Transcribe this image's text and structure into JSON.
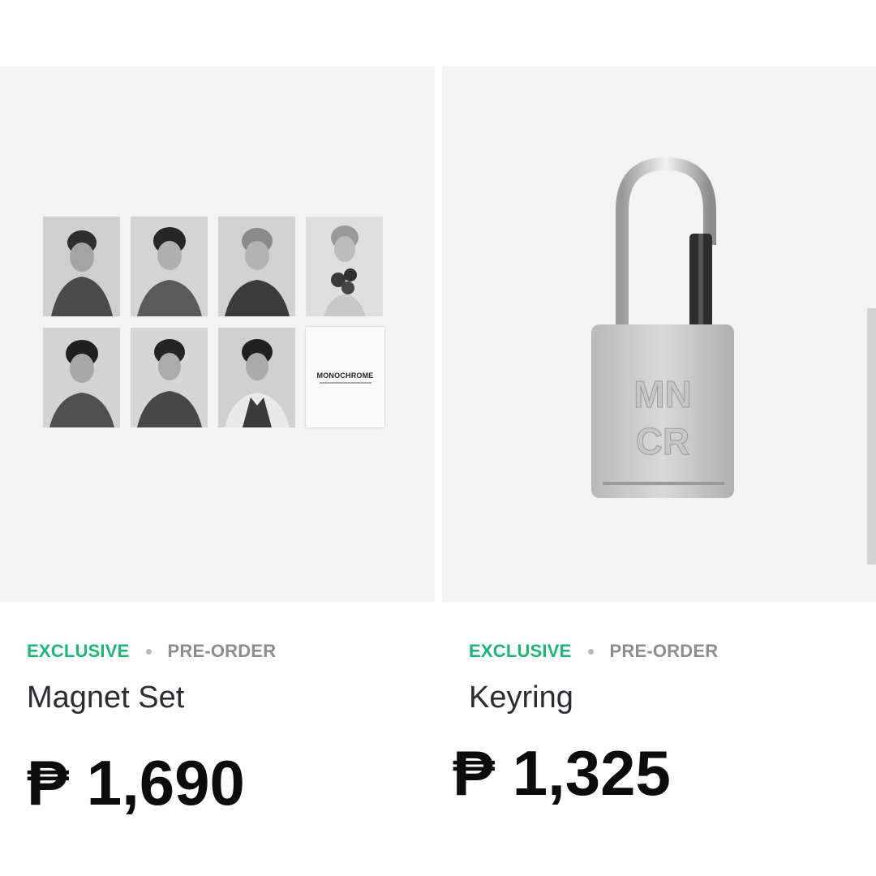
{
  "products": [
    {
      "image_alt": "magnet-set-image",
      "badge_exclusive": "EXCLUSIVE",
      "badge_preorder": "PRE-ORDER",
      "name": "Magnet Set",
      "price": "₱ 1,690",
      "magnet_card_title": "MONOCHROME"
    },
    {
      "image_alt": "keyring-image",
      "badge_exclusive": "EXCLUSIVE",
      "badge_preorder": "PRE-ORDER",
      "name": "Keyring",
      "price": "₱ 1,325",
      "padlock_engraving": "MN CR"
    }
  ],
  "colors": {
    "exclusive": "#1fb574",
    "preorder": "#8a8e93",
    "image_bg": "#f3f3f3",
    "price": "#0c0c0c"
  }
}
